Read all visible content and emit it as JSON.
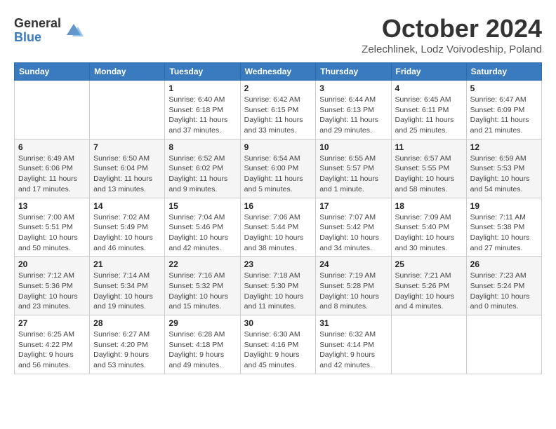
{
  "header": {
    "logo": {
      "general": "General",
      "blue": "Blue"
    },
    "title": "October 2024",
    "location": "Zelechlinek, Lodz Voivodeship, Poland"
  },
  "weekdays": [
    "Sunday",
    "Monday",
    "Tuesday",
    "Wednesday",
    "Thursday",
    "Friday",
    "Saturday"
  ],
  "weeks": [
    [
      {
        "day": "",
        "info": ""
      },
      {
        "day": "",
        "info": ""
      },
      {
        "day": "1",
        "info": "Sunrise: 6:40 AM\nSunset: 6:18 PM\nDaylight: 11 hours\nand 37 minutes."
      },
      {
        "day": "2",
        "info": "Sunrise: 6:42 AM\nSunset: 6:15 PM\nDaylight: 11 hours\nand 33 minutes."
      },
      {
        "day": "3",
        "info": "Sunrise: 6:44 AM\nSunset: 6:13 PM\nDaylight: 11 hours\nand 29 minutes."
      },
      {
        "day": "4",
        "info": "Sunrise: 6:45 AM\nSunset: 6:11 PM\nDaylight: 11 hours\nand 25 minutes."
      },
      {
        "day": "5",
        "info": "Sunrise: 6:47 AM\nSunset: 6:09 PM\nDaylight: 11 hours\nand 21 minutes."
      }
    ],
    [
      {
        "day": "6",
        "info": "Sunrise: 6:49 AM\nSunset: 6:06 PM\nDaylight: 11 hours\nand 17 minutes."
      },
      {
        "day": "7",
        "info": "Sunrise: 6:50 AM\nSunset: 6:04 PM\nDaylight: 11 hours\nand 13 minutes."
      },
      {
        "day": "8",
        "info": "Sunrise: 6:52 AM\nSunset: 6:02 PM\nDaylight: 11 hours\nand 9 minutes."
      },
      {
        "day": "9",
        "info": "Sunrise: 6:54 AM\nSunset: 6:00 PM\nDaylight: 11 hours\nand 5 minutes."
      },
      {
        "day": "10",
        "info": "Sunrise: 6:55 AM\nSunset: 5:57 PM\nDaylight: 11 hours\nand 1 minute."
      },
      {
        "day": "11",
        "info": "Sunrise: 6:57 AM\nSunset: 5:55 PM\nDaylight: 10 hours\nand 58 minutes."
      },
      {
        "day": "12",
        "info": "Sunrise: 6:59 AM\nSunset: 5:53 PM\nDaylight: 10 hours\nand 54 minutes."
      }
    ],
    [
      {
        "day": "13",
        "info": "Sunrise: 7:00 AM\nSunset: 5:51 PM\nDaylight: 10 hours\nand 50 minutes."
      },
      {
        "day": "14",
        "info": "Sunrise: 7:02 AM\nSunset: 5:49 PM\nDaylight: 10 hours\nand 46 minutes."
      },
      {
        "day": "15",
        "info": "Sunrise: 7:04 AM\nSunset: 5:46 PM\nDaylight: 10 hours\nand 42 minutes."
      },
      {
        "day": "16",
        "info": "Sunrise: 7:06 AM\nSunset: 5:44 PM\nDaylight: 10 hours\nand 38 minutes."
      },
      {
        "day": "17",
        "info": "Sunrise: 7:07 AM\nSunset: 5:42 PM\nDaylight: 10 hours\nand 34 minutes."
      },
      {
        "day": "18",
        "info": "Sunrise: 7:09 AM\nSunset: 5:40 PM\nDaylight: 10 hours\nand 30 minutes."
      },
      {
        "day": "19",
        "info": "Sunrise: 7:11 AM\nSunset: 5:38 PM\nDaylight: 10 hours\nand 27 minutes."
      }
    ],
    [
      {
        "day": "20",
        "info": "Sunrise: 7:12 AM\nSunset: 5:36 PM\nDaylight: 10 hours\nand 23 minutes."
      },
      {
        "day": "21",
        "info": "Sunrise: 7:14 AM\nSunset: 5:34 PM\nDaylight: 10 hours\nand 19 minutes."
      },
      {
        "day": "22",
        "info": "Sunrise: 7:16 AM\nSunset: 5:32 PM\nDaylight: 10 hours\nand 15 minutes."
      },
      {
        "day": "23",
        "info": "Sunrise: 7:18 AM\nSunset: 5:30 PM\nDaylight: 10 hours\nand 11 minutes."
      },
      {
        "day": "24",
        "info": "Sunrise: 7:19 AM\nSunset: 5:28 PM\nDaylight: 10 hours\nand 8 minutes."
      },
      {
        "day": "25",
        "info": "Sunrise: 7:21 AM\nSunset: 5:26 PM\nDaylight: 10 hours\nand 4 minutes."
      },
      {
        "day": "26",
        "info": "Sunrise: 7:23 AM\nSunset: 5:24 PM\nDaylight: 10 hours\nand 0 minutes."
      }
    ],
    [
      {
        "day": "27",
        "info": "Sunrise: 6:25 AM\nSunset: 4:22 PM\nDaylight: 9 hours\nand 56 minutes."
      },
      {
        "day": "28",
        "info": "Sunrise: 6:27 AM\nSunset: 4:20 PM\nDaylight: 9 hours\nand 53 minutes."
      },
      {
        "day": "29",
        "info": "Sunrise: 6:28 AM\nSunset: 4:18 PM\nDaylight: 9 hours\nand 49 minutes."
      },
      {
        "day": "30",
        "info": "Sunrise: 6:30 AM\nSunset: 4:16 PM\nDaylight: 9 hours\nand 45 minutes."
      },
      {
        "day": "31",
        "info": "Sunrise: 6:32 AM\nSunset: 4:14 PM\nDaylight: 9 hours\nand 42 minutes."
      },
      {
        "day": "",
        "info": ""
      },
      {
        "day": "",
        "info": ""
      }
    ]
  ]
}
